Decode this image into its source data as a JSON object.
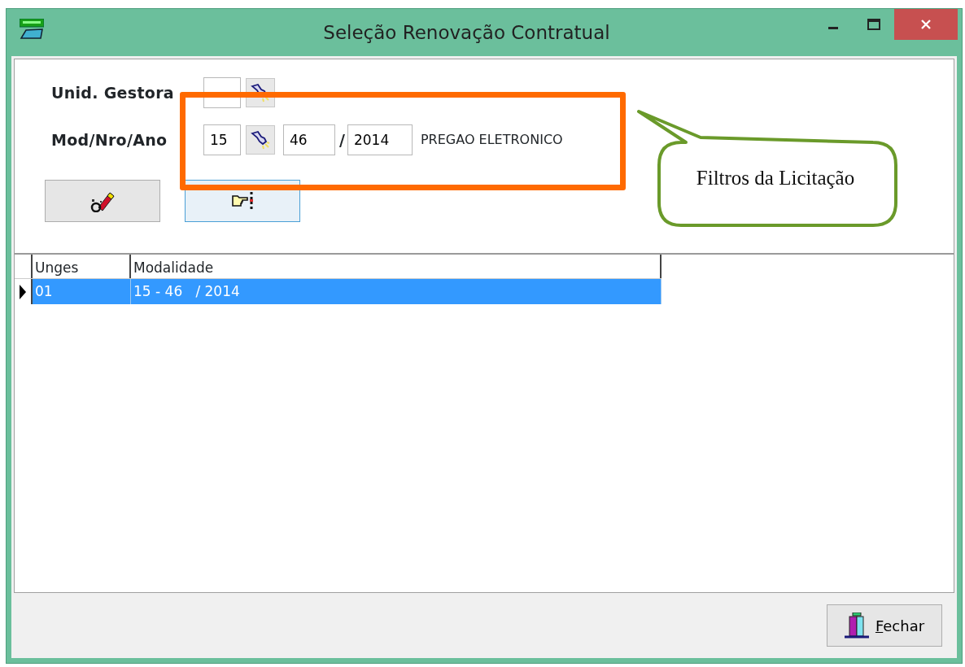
{
  "window": {
    "title": "Seleção Renovação Contratual"
  },
  "filters": {
    "unid_gestora": {
      "label": "Unid. Gestora"
    },
    "mod_nro_ano": {
      "label": "Mod/Nro/Ano",
      "modalidade": "15",
      "numero": "46",
      "separator": "/",
      "ano": "2014",
      "description": "PREGAO ELETRONICO"
    }
  },
  "grid": {
    "columns": [
      "Unges",
      "Modalidade"
    ],
    "rows": [
      {
        "cells": [
          "01",
          "15 - 46   / 2014"
        ],
        "selected": true
      }
    ]
  },
  "callout": {
    "text": "Filtros da Licitação"
  },
  "footer": {
    "close_button": "Fechar"
  }
}
